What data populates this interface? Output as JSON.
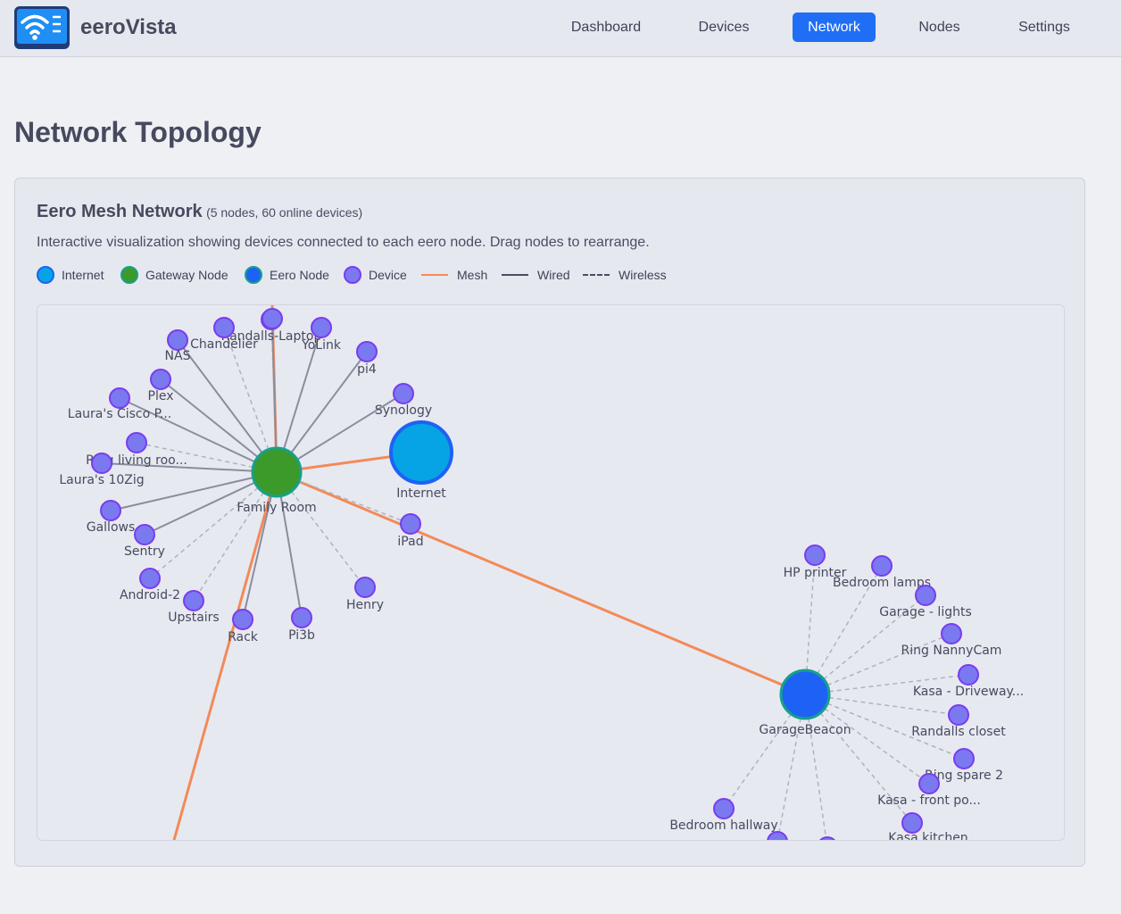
{
  "app": {
    "name": "eeroVista"
  },
  "nav": {
    "items": [
      "Dashboard",
      "Devices",
      "Network",
      "Nodes",
      "Settings"
    ],
    "active": "Network"
  },
  "page": {
    "title": "Network Topology"
  },
  "card": {
    "title": "Eero Mesh Network",
    "subtitle": "(5 nodes, 60 online devices)",
    "description": "Interactive visualization showing devices connected to each eero node. Drag nodes to rearrange."
  },
  "legend": {
    "internet": "Internet",
    "gateway": "Gateway Node",
    "eero": "Eero Node",
    "device": "Device",
    "mesh": "Mesh",
    "wired": "Wired",
    "wireless": "Wireless"
  },
  "colors": {
    "internet": "#06a4e5",
    "gateway": "#3b9a2a",
    "eero": "#1e62f5",
    "device": "#7a79f0",
    "device_border": "#7a3cf0",
    "mesh": "#f38a58",
    "wired": "#8b8d9c",
    "wireless": "#b0b2bf",
    "active": "#1f6ef5"
  },
  "topology": {
    "internet": {
      "label": "Internet"
    },
    "gateway": {
      "label": "Family Room"
    },
    "eero_node": {
      "label": "GarageBeacon"
    },
    "family_room_devices": [
      {
        "label": "Randalls-Laptop",
        "link": "wireless"
      },
      {
        "label": "Chandelier",
        "link": "wireless"
      },
      {
        "label": "NAS",
        "link": "wired"
      },
      {
        "label": "Plex",
        "link": "wired"
      },
      {
        "label": "Laura's Cisco P...",
        "link": "wired"
      },
      {
        "label": "Ring living roo...",
        "link": "wireless"
      },
      {
        "label": "Laura's 10Zig",
        "link": "wired"
      },
      {
        "label": "Gallows",
        "link": "wired"
      },
      {
        "label": "Sentry",
        "link": "wired"
      },
      {
        "label": "Android-2",
        "link": "wireless"
      },
      {
        "label": "Upstairs",
        "link": "wireless"
      },
      {
        "label": "Rack",
        "link": "wired"
      },
      {
        "label": "Pi3b",
        "link": "wired"
      },
      {
        "label": "Henry",
        "link": "wireless"
      },
      {
        "label": "iPad",
        "link": "wireless"
      },
      {
        "label": "Synology",
        "link": "wired"
      },
      {
        "label": "pi4",
        "link": "wired"
      },
      {
        "label": "YoLink",
        "link": "wired"
      },
      {
        "label": "",
        "link": "wired"
      }
    ],
    "garage_devices": [
      {
        "label": "HP printer",
        "link": "wireless"
      },
      {
        "label": "Bedroom lamps",
        "link": "wireless"
      },
      {
        "label": "Garage - lights",
        "link": "wireless"
      },
      {
        "label": "Ring NannyCam",
        "link": "wireless"
      },
      {
        "label": "Kasa - Driveway...",
        "link": "wireless"
      },
      {
        "label": "Randalls closet",
        "link": "wireless"
      },
      {
        "label": "Ring spare 2",
        "link": "wireless"
      },
      {
        "label": "Kasa - front po...",
        "link": "wireless"
      },
      {
        "label": "Kasa kitchen",
        "link": "wireless"
      },
      {
        "label": "Bedroom hallway",
        "link": "wireless"
      },
      {
        "label": "",
        "link": "wireless"
      },
      {
        "label": "",
        "link": "wireless"
      }
    ]
  }
}
